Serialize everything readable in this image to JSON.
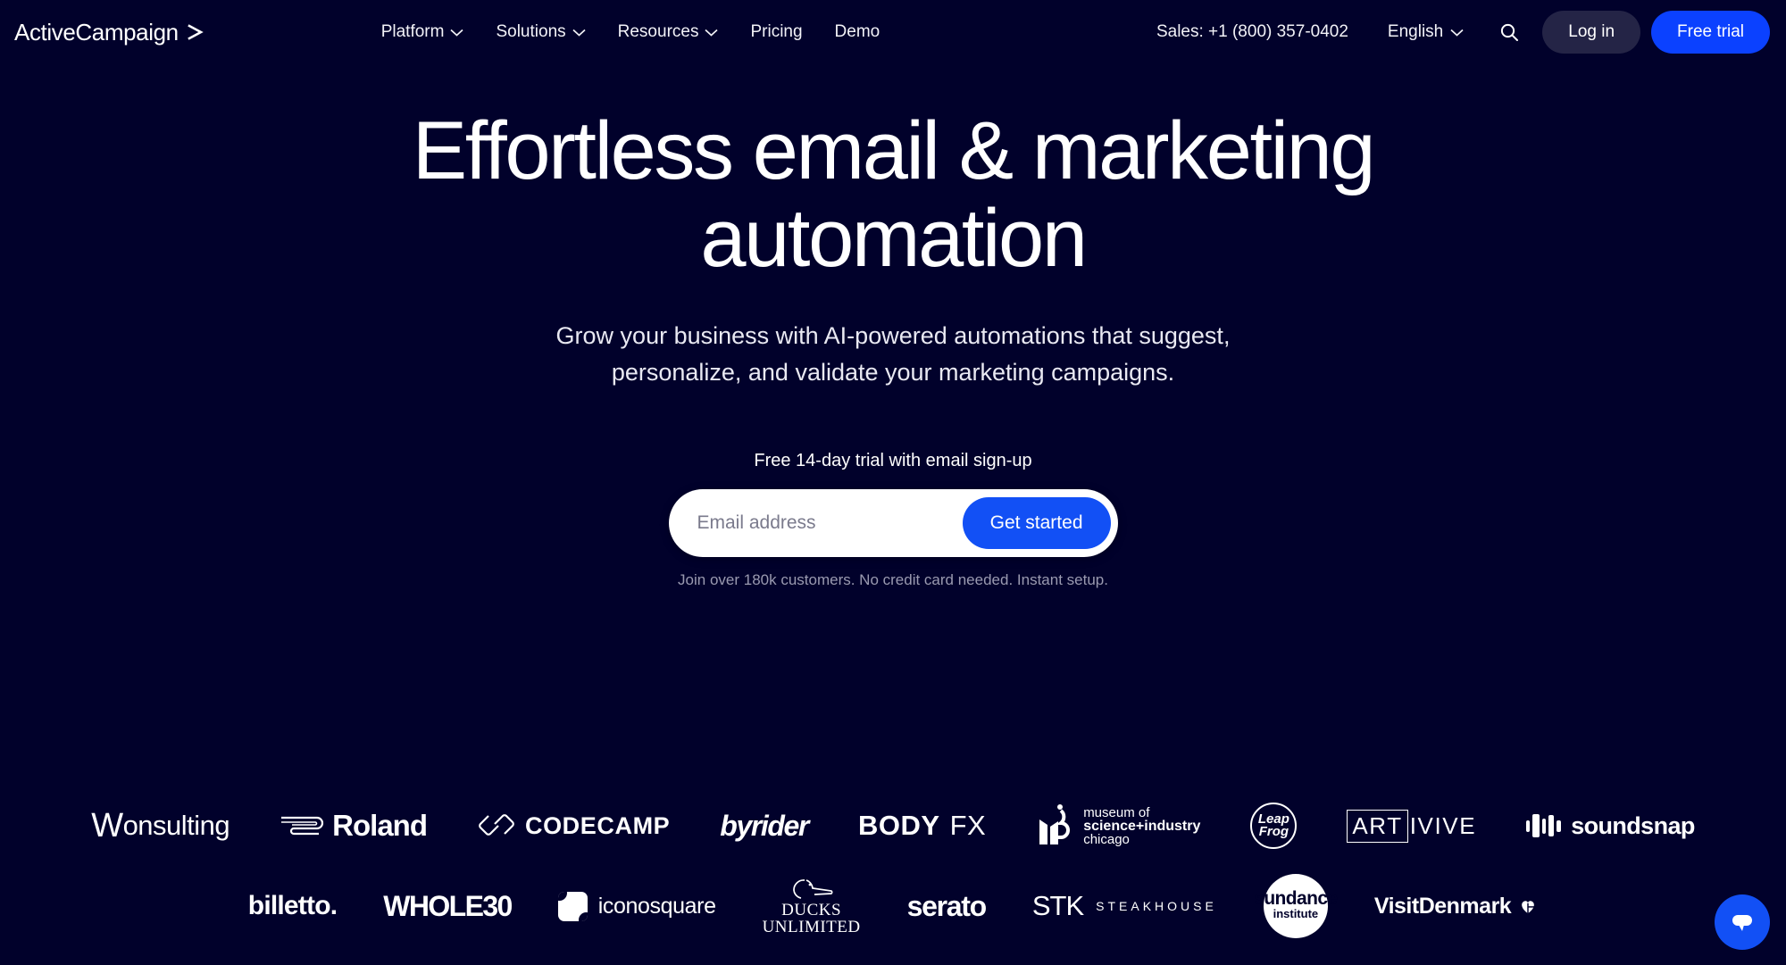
{
  "theme": {
    "background": "#01012b",
    "accent_blue": "#0b41ff",
    "button_blue": "#1250f5",
    "login_bg": "#242446",
    "text_white": "#ffffff",
    "muted_text": "#9a9ab0"
  },
  "nav": {
    "logo_text": "ActiveCampaign",
    "logo_icon": "chevron-right-arrow-icon",
    "links": [
      {
        "label": "Platform",
        "has_dropdown": true
      },
      {
        "label": "Solutions",
        "has_dropdown": true
      },
      {
        "label": "Resources",
        "has_dropdown": true
      },
      {
        "label": "Pricing",
        "has_dropdown": false
      },
      {
        "label": "Demo",
        "has_dropdown": false
      }
    ],
    "sales_phone": "Sales: +1 (800) 357-0402",
    "language": "English",
    "search_icon": "search-icon",
    "login_label": "Log in",
    "trial_label": "Free trial"
  },
  "hero": {
    "headline_line1": "Effortless email & marketing",
    "headline_line2": "automation",
    "subheadline": "Grow your business with AI-powered automations that suggest, personalize, and validate your marketing campaigns."
  },
  "signup": {
    "trial_label": "Free 14-day trial with email sign-up",
    "email_placeholder": "Email address",
    "email_value": "",
    "cta_label": "Get started",
    "fineprint": "Join over 180k customers. No credit card needed. Instant setup."
  },
  "logos": {
    "row1": [
      {
        "name": "Wonsulting"
      },
      {
        "name": "Roland"
      },
      {
        "name": "CODECAMP"
      },
      {
        "name": "byrider"
      },
      {
        "name": "BODY FX"
      },
      {
        "name": "museum of science+industry chicago"
      },
      {
        "name": "LeapFrog"
      },
      {
        "name": "ARTIVIVE"
      },
      {
        "name": "soundsnap"
      }
    ],
    "row2": [
      {
        "name": "billetto."
      },
      {
        "name": "WHOLE30"
      },
      {
        "name": "iconosquare"
      },
      {
        "name": "DUCKS UNLIMITED"
      },
      {
        "name": "serato"
      },
      {
        "name": "STK STEAKHOUSE"
      },
      {
        "name": "sundance institute"
      },
      {
        "name": "VisitDenmark"
      }
    ],
    "text": {
      "wonsulting_w": "W",
      "wonsulting_rest": "onsulting",
      "roland": "Roland",
      "codecamp": "CODECAMP",
      "byrider": "byrider",
      "body": "BODY",
      "fx": "FX",
      "msi_l1": "museum of",
      "msi_l2": "science+industry",
      "msi_l3": "chicago",
      "leap": "Leap",
      "frog": "Frog",
      "art": "ART",
      "ivive": "IVIVE",
      "soundsnap": "soundsnap",
      "billetto": "billetto.",
      "whole30": "WHOLE30",
      "iconosquare": "iconosquare",
      "ducks": "DUCKS",
      "unlimited": "UNLIMITED",
      "serato": "serato",
      "stk": "STK",
      "steakhouse": "STEAKHOUSE",
      "sundance": "sundance",
      "institute": "institute",
      "visitdenmark": "VisitDenmark"
    }
  },
  "chat": {
    "icon": "chat-bubble-icon",
    "label": "Open chat"
  }
}
